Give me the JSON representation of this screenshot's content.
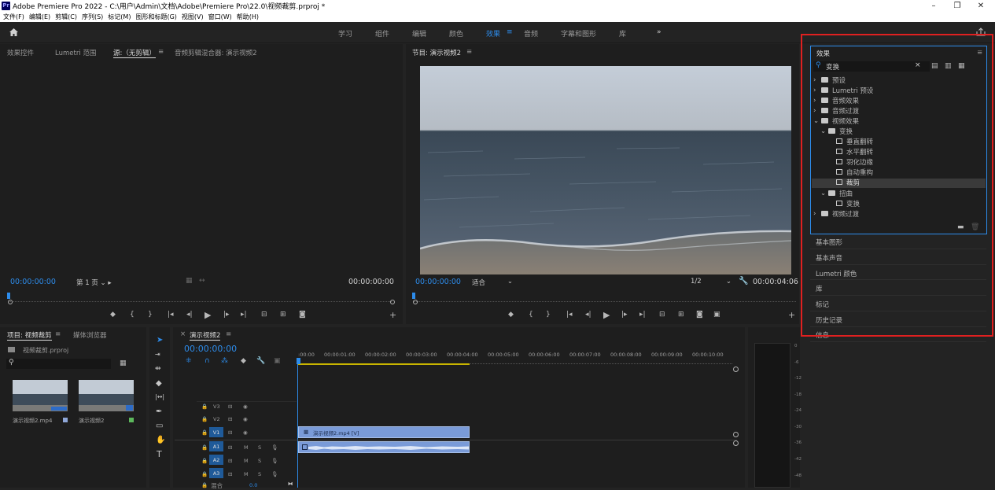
{
  "window": {
    "title": "Adobe Premiere Pro 2022 - C:\\用户\\Admin\\文档\\Adobe\\Premiere Pro\\22.0\\视频裁剪.prproj *",
    "logo": "Pr"
  },
  "menu": [
    "文件(F)",
    "编辑(E)",
    "剪辑(C)",
    "序列(S)",
    "标记(M)",
    "图形和标题(G)",
    "视图(V)",
    "窗口(W)",
    "帮助(H)"
  ],
  "workspaces": {
    "items": [
      "学习",
      "组件",
      "编辑",
      "颜色",
      "效果",
      "音频",
      "字幕和图形",
      "库"
    ],
    "active": "效果",
    "more": "»"
  },
  "source_panel": {
    "tabs": [
      "效果控件",
      "Lumetri 范围",
      "源:（无剪辑）",
      "音频剪辑混合器: 演示视频2"
    ],
    "menu_glyph": "≡",
    "timecode_left": "00:00:00:00",
    "page_label": "第 1 页",
    "timecode_right": "00:00:00:00"
  },
  "program_panel": {
    "title": "节目: 演示视频2",
    "menu_glyph": "≡",
    "timecode_left": "00:00:00:00",
    "fit": "适合",
    "resolution": "1/2",
    "timecode_right": "00:00:04:06"
  },
  "effects_panel": {
    "title": "效果",
    "search_value": "变换",
    "clear": "×",
    "tree": [
      {
        "label": "预设",
        "indent": 0,
        "kind": "folder-open",
        "arrow": "›"
      },
      {
        "label": "Lumetri 预设",
        "indent": 0,
        "kind": "folder-open",
        "arrow": "›"
      },
      {
        "label": "音频效果",
        "indent": 0,
        "kind": "folder",
        "arrow": "›"
      },
      {
        "label": "音频过渡",
        "indent": 0,
        "kind": "folder",
        "arrow": "›"
      },
      {
        "label": "视频效果",
        "indent": 0,
        "kind": "folder",
        "arrow": "⌄"
      },
      {
        "label": "变换",
        "indent": 1,
        "kind": "folder",
        "arrow": "⌄"
      },
      {
        "label": "垂直翻转",
        "indent": 2,
        "kind": "fx",
        "arrow": ""
      },
      {
        "label": "水平翻转",
        "indent": 2,
        "kind": "fx",
        "arrow": ""
      },
      {
        "label": "羽化边缘",
        "indent": 2,
        "kind": "fx",
        "arrow": ""
      },
      {
        "label": "自动重构",
        "indent": 2,
        "kind": "fx",
        "arrow": ""
      },
      {
        "label": "裁剪",
        "indent": 2,
        "kind": "fx",
        "arrow": "",
        "selected": true
      },
      {
        "label": "扭曲",
        "indent": 1,
        "kind": "folder",
        "arrow": "⌄"
      },
      {
        "label": "变换",
        "indent": 2,
        "kind": "fx",
        "arrow": ""
      },
      {
        "label": "视频过渡",
        "indent": 0,
        "kind": "folder",
        "arrow": "›"
      }
    ]
  },
  "side_panels": [
    "基本图形",
    "基本声音",
    "Lumetri 颜色",
    "库",
    "标记",
    "历史记录",
    "信息"
  ],
  "project_panel": {
    "tabs": [
      "项目: 视频裁剪",
      "媒体浏览器"
    ],
    "menu_glyph": "≡",
    "file": "视频裁剪.prproj",
    "items": [
      {
        "name": "演示视频2.mp4",
        "color": "#8fa7d8"
      },
      {
        "name": "演示视频2",
        "color": "#5cb85c"
      }
    ]
  },
  "timeline": {
    "tab": "演示视频2",
    "menu_glyph": "≡",
    "timecode": "00:00:00:00",
    "ruler": [
      ":00:00",
      "00:00:01:00",
      "00:00:02:00",
      "00:00:03:00",
      "00:00:04:00",
      "00:00:05:00",
      "00:00:06:00",
      "00:00:07:00",
      "00:00:08:00",
      "00:00:09:00",
      "00:00:10:00"
    ],
    "video_tracks": [
      "V3",
      "V2",
      "V1"
    ],
    "audio_tracks": [
      "A1",
      "A2",
      "A3"
    ],
    "mix_label": "混合",
    "mix_value": "0.0",
    "clip_label": "演示视频2.mp4 [V]",
    "m_label": "M",
    "s_label": "S"
  },
  "audio_meter": {
    "scale": [
      "0",
      "-6",
      "-12",
      "-18",
      "-24",
      "-30",
      "-36",
      "-42",
      "-48"
    ]
  },
  "colors": {
    "accent": "#2d8ceb",
    "clip_video": "#7a9bd8",
    "clip_audio": "#7a9bd8",
    "highlight_box": "#e02020",
    "selected_row": "#3a3a3a"
  }
}
